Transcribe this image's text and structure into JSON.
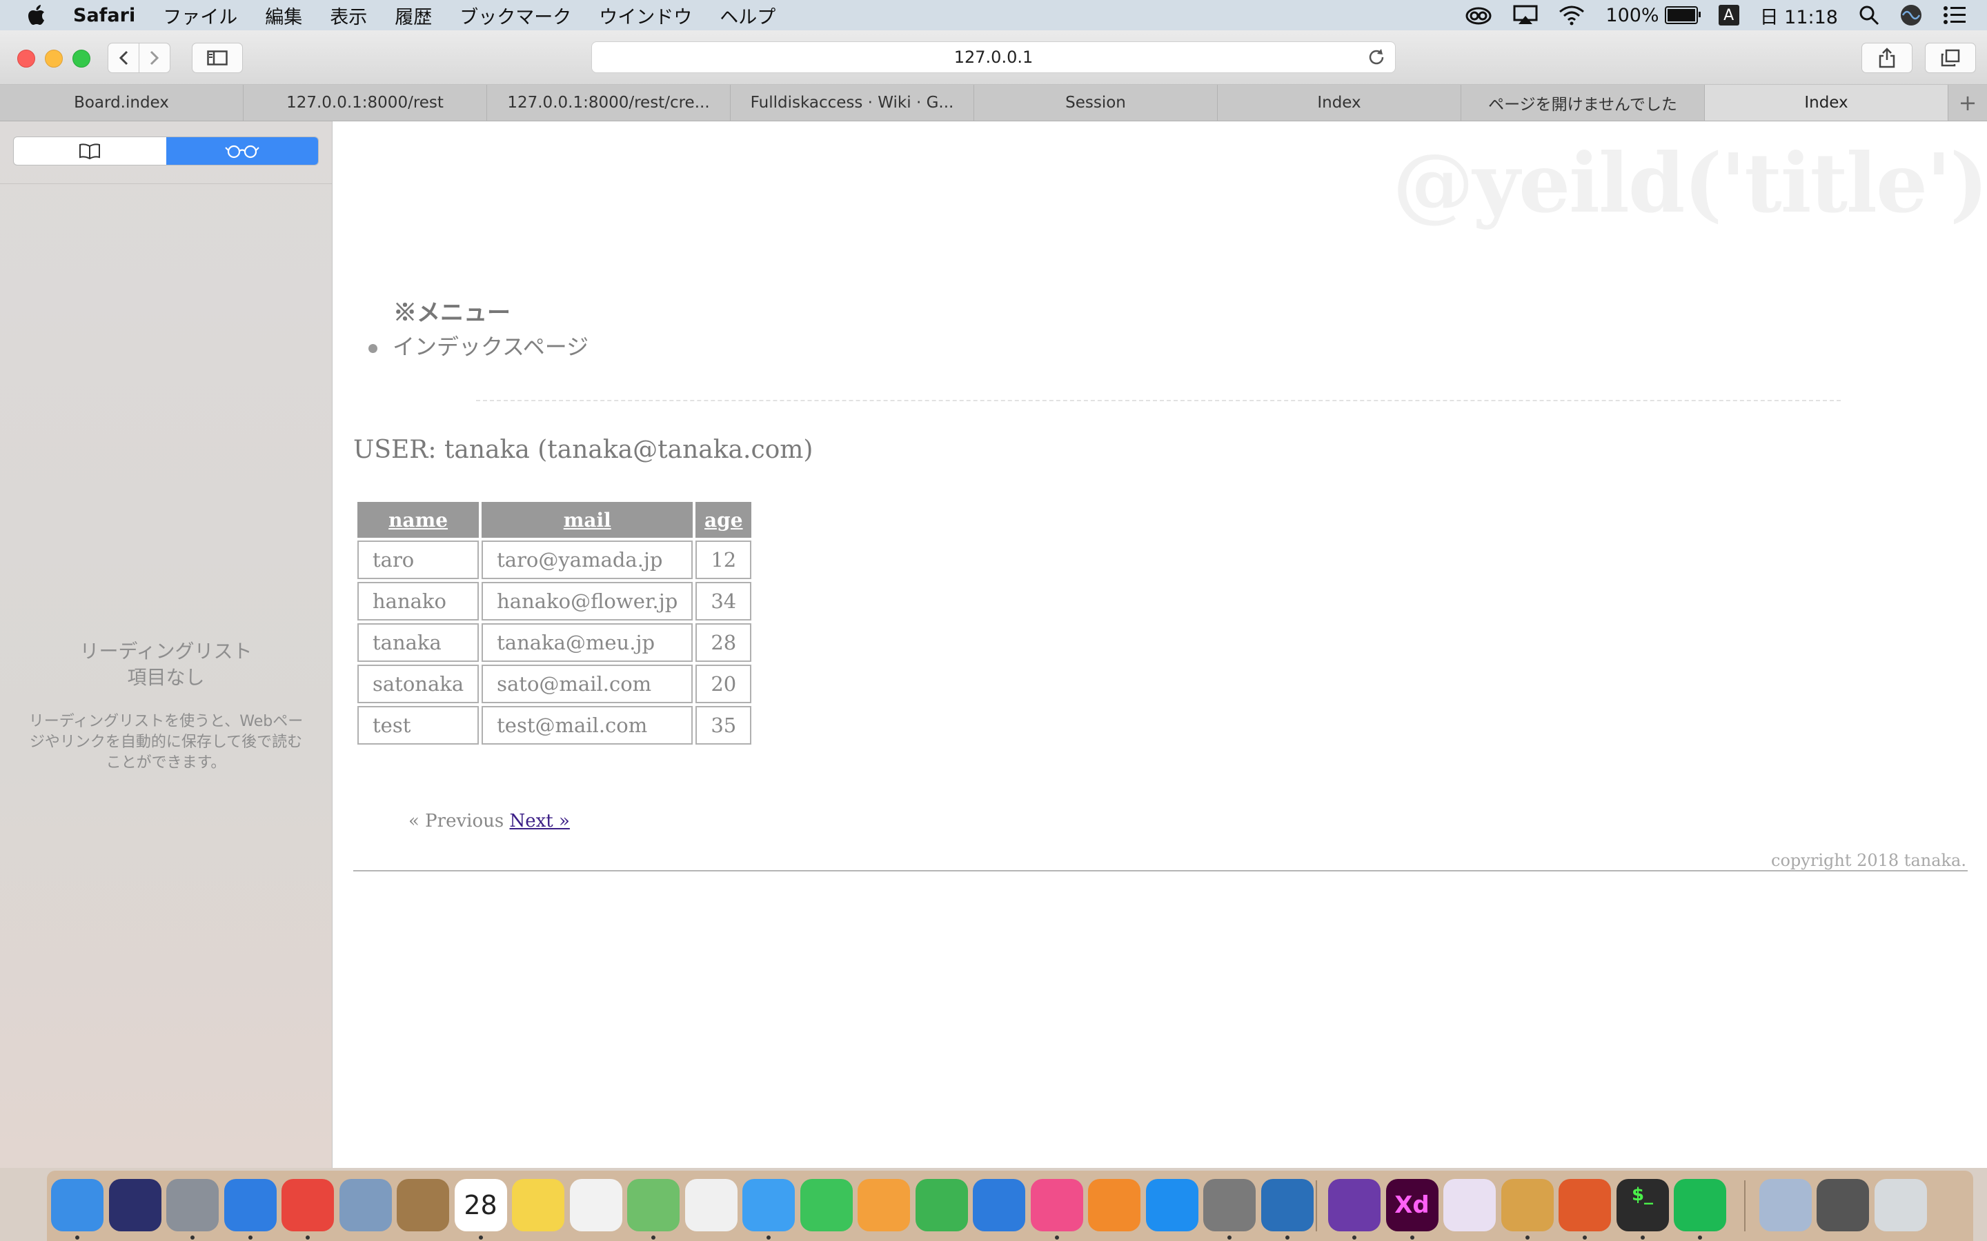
{
  "menubar": {
    "app_name": "Safari",
    "items": [
      "ファイル",
      "編集",
      "表示",
      "履歴",
      "ブックマーク",
      "ウインドウ",
      "ヘルプ"
    ],
    "battery": "100%",
    "ime": "A",
    "clock": "日 11:18"
  },
  "toolbar": {
    "address": "127.0.0.1"
  },
  "tabs": [
    {
      "label": "Board.index"
    },
    {
      "label": "127.0.0.1:8000/rest"
    },
    {
      "label": "127.0.0.1:8000/rest/cre..."
    },
    {
      "label": "Fulldiskaccess · Wiki · G..."
    },
    {
      "label": "Session"
    },
    {
      "label": "Index"
    },
    {
      "label": "ページを開けませんでした"
    },
    {
      "label": "Index"
    }
  ],
  "sidebar": {
    "reading_list_title_1": "リーディングリスト",
    "reading_list_title_2": "項目なし",
    "reading_list_desc": "リーディングリストを使うと、Webページやリンクを自動的に保存して後で読むことができます。"
  },
  "page": {
    "watermark": "@yeild('title')",
    "menu_heading": "※メニュー",
    "menu_items": [
      "インデックスページ"
    ],
    "user_line": "USER: tanaka (tanaka@tanaka.com)",
    "table": {
      "headers": [
        "name",
        "mail",
        "age"
      ],
      "rows": [
        [
          "taro",
          "taro@yamada.jp",
          "12"
        ],
        [
          "hanako",
          "hanako@flower.jp",
          "34"
        ],
        [
          "tanaka",
          "tanaka@meu.jp",
          "28"
        ],
        [
          "satonaka",
          "sato@mail.com",
          "20"
        ],
        [
          "test",
          "test@mail.com",
          "35"
        ]
      ]
    },
    "pager_prev": "« Previous",
    "pager_next": "Next »",
    "copyright": "copyright 2018 tanaka."
  },
  "dock": {
    "icons": [
      {
        "name": "finder",
        "color": "#3a8ee6",
        "glyph": ""
      },
      {
        "name": "siri",
        "color": "#2b2f6b",
        "glyph": ""
      },
      {
        "name": "launchpad",
        "color": "#8a9099",
        "glyph": ""
      },
      {
        "name": "safari",
        "color": "#2f7de1",
        "glyph": ""
      },
      {
        "name": "chrome",
        "color": "#e8453c",
        "glyph": ""
      },
      {
        "name": "preview",
        "color": "#7d9bbf",
        "glyph": ""
      },
      {
        "name": "notes-brown",
        "color": "#a07a4a",
        "glyph": ""
      },
      {
        "name": "calendar",
        "color": "#ffffff",
        "glyph": "28"
      },
      {
        "name": "notes",
        "color": "#f5d44a",
        "glyph": ""
      },
      {
        "name": "reminders",
        "color": "#f2f2f2",
        "glyph": ""
      },
      {
        "name": "maps",
        "color": "#6fbf6a",
        "glyph": ""
      },
      {
        "name": "photos",
        "color": "#f0f0f0",
        "glyph": ""
      },
      {
        "name": "messages",
        "color": "#3ea0f2",
        "glyph": ""
      },
      {
        "name": "facetime",
        "color": "#3cc35a",
        "glyph": ""
      },
      {
        "name": "pages",
        "color": "#f3a03c",
        "glyph": ""
      },
      {
        "name": "numbers",
        "color": "#3db352",
        "glyph": ""
      },
      {
        "name": "keynote",
        "color": "#2d7bdc",
        "glyph": ""
      },
      {
        "name": "itunes",
        "color": "#f04e8a",
        "glyph": ""
      },
      {
        "name": "books",
        "color": "#f28a2b",
        "glyph": ""
      },
      {
        "name": "app-store",
        "color": "#1e8ef0",
        "glyph": ""
      },
      {
        "name": "system-preferences",
        "color": "#7a7a7a",
        "glyph": ""
      },
      {
        "name": "vscode",
        "color": "#2a6fb8",
        "glyph": ""
      },
      {
        "name": "visual-studio",
        "color": "#6b3aa8",
        "glyph": ""
      },
      {
        "name": "adobe-xd",
        "color": "#470137",
        "glyph": "Xd"
      },
      {
        "name": "atom",
        "color": "#e9e0f2",
        "glyph": ""
      },
      {
        "name": "garageband",
        "color": "#d8a24a",
        "glyph": ""
      },
      {
        "name": "keyboard-app",
        "color": "#e05a2a",
        "glyph": ""
      },
      {
        "name": "terminal",
        "color": "#2b2b2b",
        "glyph": "$_"
      },
      {
        "name": "spotify",
        "color": "#1db954",
        "glyph": ""
      },
      {
        "name": "documents-folder",
        "color": "#a7b9d3",
        "glyph": ""
      },
      {
        "name": "downloads-folder",
        "color": "#555555",
        "glyph": ""
      },
      {
        "name": "trash",
        "color": "#d6dadd",
        "glyph": ""
      }
    ]
  }
}
